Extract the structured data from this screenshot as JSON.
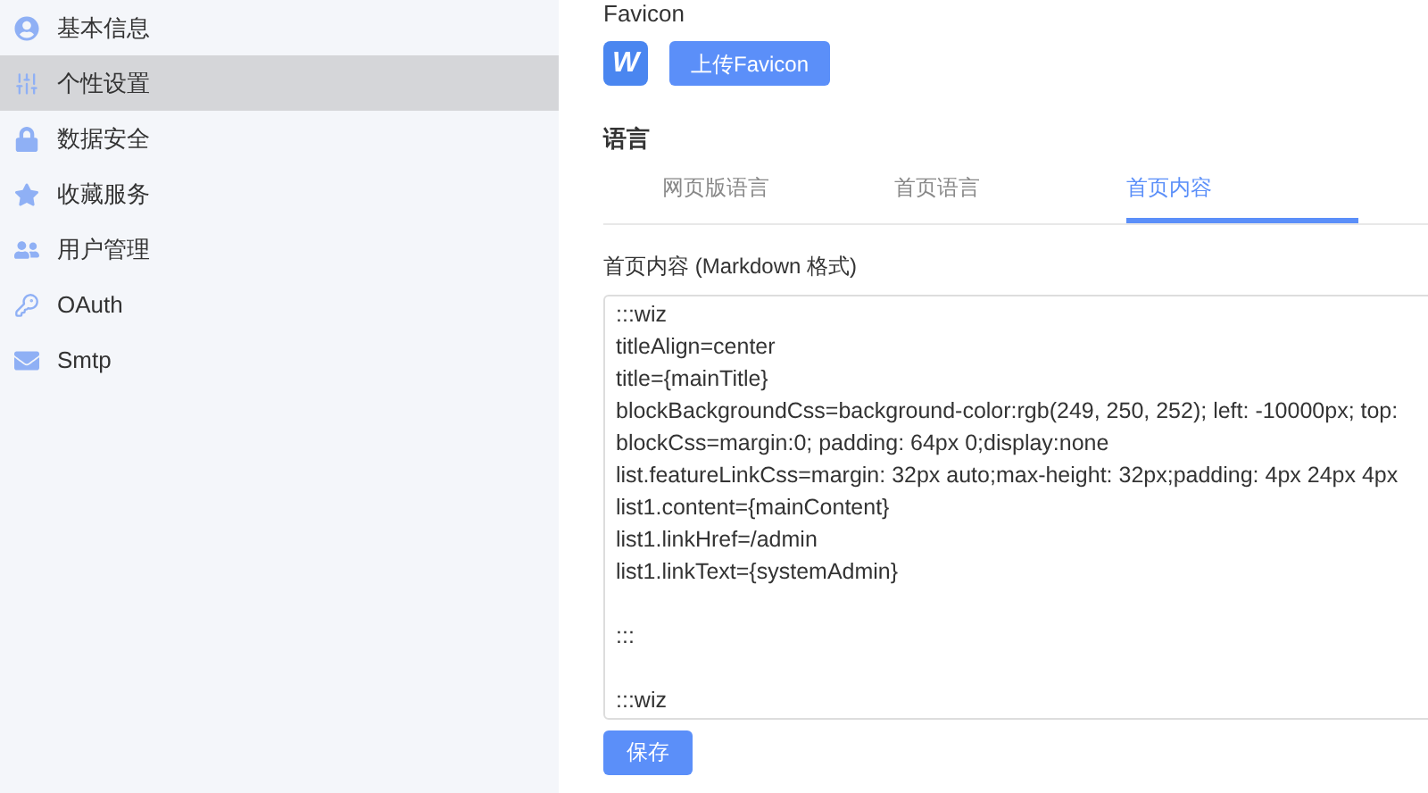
{
  "sidebar": {
    "items": [
      {
        "label": "基本信息",
        "selected": false
      },
      {
        "label": "个性设置",
        "selected": true
      },
      {
        "label": "数据安全",
        "selected": false
      },
      {
        "label": "收藏服务",
        "selected": false
      },
      {
        "label": "用户管理",
        "selected": false
      },
      {
        "label": "OAuth",
        "selected": false
      },
      {
        "label": "Smtp",
        "selected": false
      }
    ]
  },
  "favicon": {
    "label": "Favicon",
    "logo_letter": "W",
    "upload_button": "上传Favicon"
  },
  "language": {
    "heading": "语言",
    "tabs": [
      {
        "label": "网页版语言",
        "selected": false
      },
      {
        "label": "首页语言",
        "selected": false
      },
      {
        "label": "首页内容",
        "selected": true
      }
    ]
  },
  "editor": {
    "label": "首页内容 (Markdown 格式)",
    "blocks": [
      [
        ":::wiz",
        "titleAlign=center",
        "title={mainTitle}",
        "blockBackgroundCss=background-color:rgb(249, 250, 252); left: -10000px; top:",
        "blockCss=margin:0; padding: 64px 0;display:none",
        "list.featureLinkCss=margin: 32px auto;max-height: 32px;padding: 4px 24px 4px",
        "list1.content={mainContent}",
        "list1.linkHref=/admin",
        "list1.linkText={systemAdmin}"
      ],
      [
        ":::"
      ],
      [
        ":::wiz"
      ]
    ]
  },
  "save_button": "保存"
}
